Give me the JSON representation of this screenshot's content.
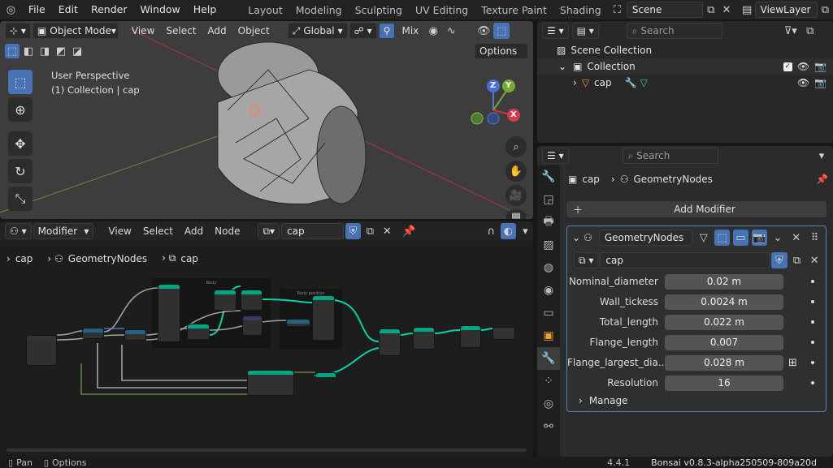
{
  "topbar": {
    "menus": [
      "File",
      "Edit",
      "Render",
      "Window",
      "Help"
    ],
    "workspaces": [
      "Layout",
      "Modeling",
      "Sculpting",
      "UV Editing",
      "Texture Paint",
      "Shading"
    ],
    "scene": "Scene",
    "view_layer": "ViewLayer"
  },
  "viewport": {
    "mode": "Object Mode",
    "menus": [
      "View",
      "Select",
      "Add",
      "Object"
    ],
    "orientation": "Global",
    "snap": "Mix",
    "options_label": "Options",
    "info_line1": "User Perspective",
    "info_line2": "(1) Collection | cap",
    "gizmo": {
      "z": "Z",
      "y": "Y",
      "x": "X"
    }
  },
  "node_editor": {
    "type": "Modifier",
    "menus": [
      "View",
      "Select",
      "Add",
      "Node"
    ],
    "tree_name": "cap",
    "breadcrumb": [
      "cap",
      "GeometryNodes",
      "cap"
    ],
    "frame1_label": "Body",
    "frame2_label": "Body position"
  },
  "outliner": {
    "search_placeholder": "Search",
    "scene_collection": "Scene Collection",
    "collection": "Collection",
    "object": "cap"
  },
  "properties": {
    "search_placeholder": "Search",
    "breadcrumb_object": "cap",
    "breadcrumb_modifier": "GeometryNodes",
    "add_modifier": "Add Modifier",
    "modifier_name": "GeometryNodes",
    "node_group": "cap",
    "params": [
      {
        "label": "Nominal_diameter",
        "value": "0.02 m"
      },
      {
        "label": "Wall_tickess",
        "value": "0.0024 m"
      },
      {
        "label": "Total_length",
        "value": "0.022 m"
      },
      {
        "label": "Flange_length",
        "value": "0.007"
      },
      {
        "label": "Flange_largest_dia...",
        "value": "0.028 m"
      },
      {
        "label": "Resolution",
        "value": "16"
      }
    ],
    "manage": "Manage"
  },
  "statusbar": {
    "pan": "Pan",
    "options": "Options",
    "version": "4.4.1",
    "addon": "Bonsai v0.8.3-alpha250509-809a20d"
  },
  "colors": {
    "accent_blue": "#4772b3",
    "socket_green": "#00d6a3",
    "selected_outline": "#5a7fc0"
  }
}
